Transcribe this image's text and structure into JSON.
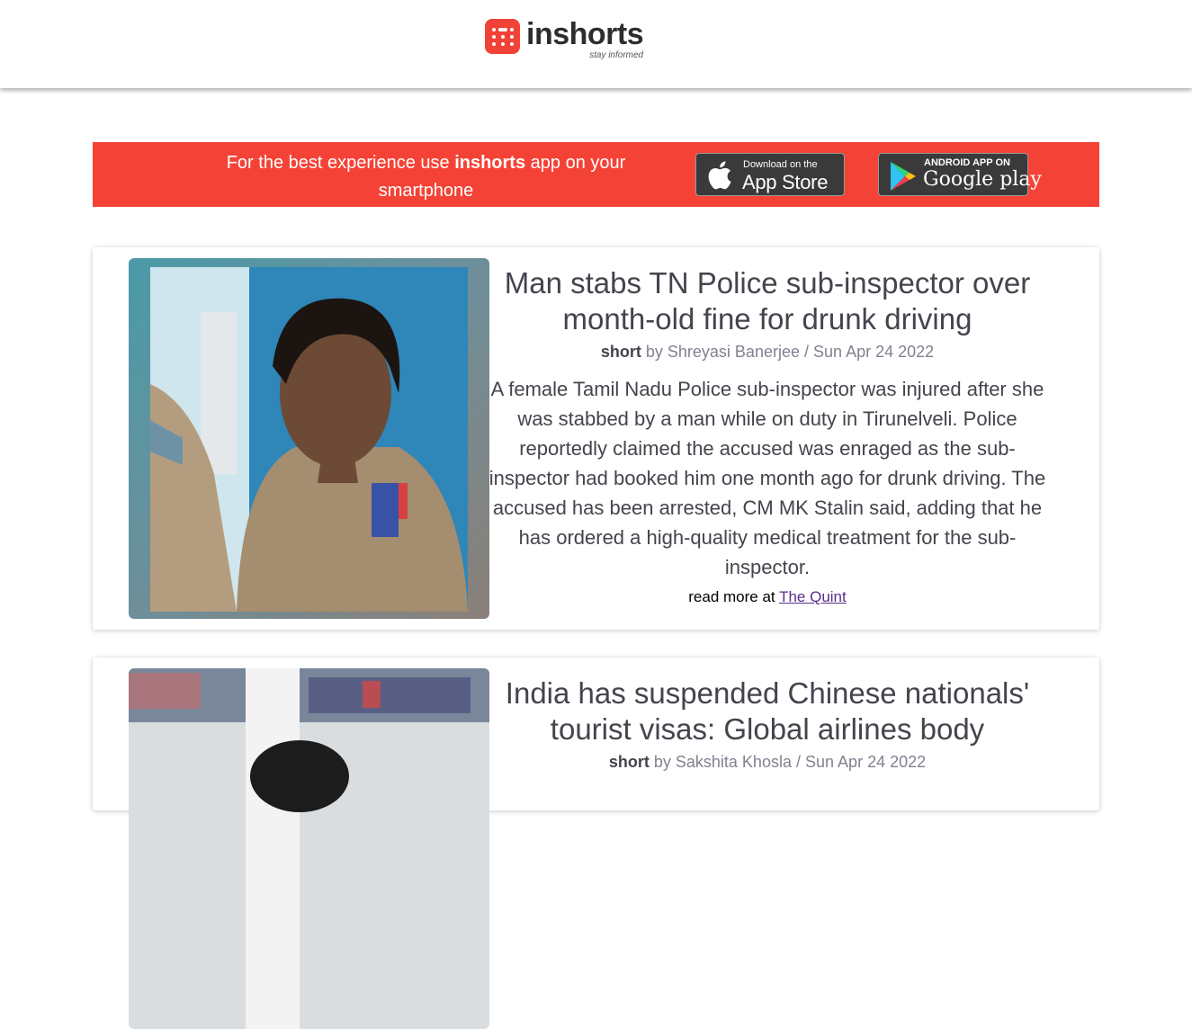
{
  "header": {
    "brand_name": "inshorts",
    "tagline": "stay informed",
    "brand_color": "#f04237"
  },
  "banner": {
    "text_before": "For the best experience use ",
    "text_bold": "inshorts",
    "text_after": " app on your smartphone",
    "background": "#f44336",
    "appstore": {
      "small": "Download on the",
      "big": "App Store",
      "icon": "apple-icon"
    },
    "googleplay": {
      "small": "ANDROID APP ON",
      "big": "Google play",
      "icon": "google-play-icon"
    }
  },
  "articles": [
    {
      "title": "Man stabs TN Police sub-inspector over month-old fine for drunk driving",
      "type": "short",
      "by": "by",
      "author": "Shreyasi Banerjee",
      "separator": "/",
      "date": "Sun Apr 24 2022",
      "content": "A female Tamil Nadu Police sub-inspector was injured after she was stabbed by a man while on duty in Tirunelveli. Police reportedly claimed the accused was enraged as the sub-inspector had booked him one month ago for drunk driving. The accused has been arrested, CM MK Stalin said, adding that he has ordered a high-quality medical treatment for the sub-inspector.",
      "read_more_prefix": "read more at",
      "source": "The Quint"
    },
    {
      "title": "India has suspended Chinese nationals' tourist visas: Global airlines body",
      "type": "short",
      "by": "by",
      "author": "Sakshita Khosla",
      "separator": "/",
      "date": "Sun Apr 24 2022"
    }
  ]
}
